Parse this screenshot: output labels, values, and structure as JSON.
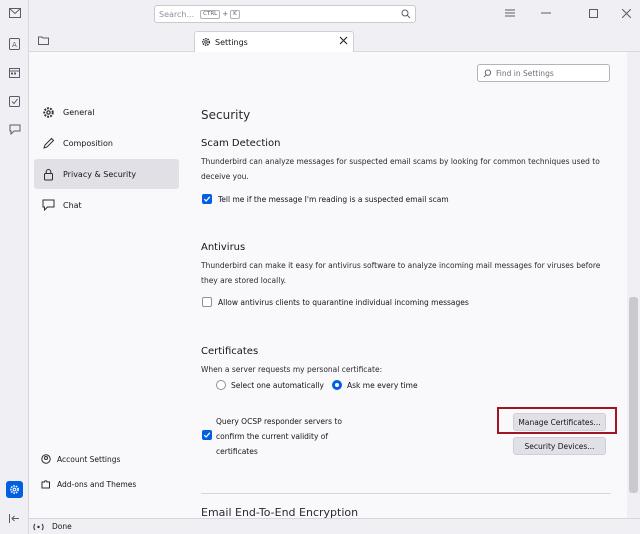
{
  "spaces": {
    "icons": [
      "mail-icon",
      "address-book-icon",
      "calendar-icon",
      "tasks-icon",
      "chat-icon",
      "settings-icon",
      "collapse-icon"
    ],
    "active": "settings-icon"
  },
  "titlebar": {
    "search_placeholder": "Search...",
    "shortcut_key1": "CTRL",
    "shortcut_plus": "+",
    "shortcut_key2": "K"
  },
  "tab": {
    "label": "Settings"
  },
  "sidebar": {
    "items": [
      {
        "label": "General",
        "icon": "gear-icon"
      },
      {
        "label": "Composition",
        "icon": "pencil-icon"
      },
      {
        "label": "Privacy & Security",
        "icon": "lock-icon",
        "selected": true
      },
      {
        "label": "Chat",
        "icon": "chat-icon"
      }
    ],
    "account_settings": "Account Settings",
    "addons": "Add-ons and Themes"
  },
  "find": {
    "placeholder": "Find in Settings"
  },
  "security": {
    "heading": "Security",
    "scam": {
      "title": "Scam Detection",
      "description": "Thunderbird can analyze messages for suspected email scams by looking for common techniques used to deceive you.",
      "checkbox_label": "Tell me if the message I'm reading is a suspected email scam",
      "checked": true
    },
    "antivirus": {
      "title": "Antivirus",
      "description": "Thunderbird can make it easy for antivirus software to analyze incoming mail messages for viruses before they are stored locally.",
      "checkbox_label": "Allow antivirus clients to quarantine individual incoming messages",
      "checked": false
    },
    "certificates": {
      "title": "Certificates",
      "request_label": "When a server requests my personal certificate:",
      "option_auto": "Select one automatically",
      "option_ask": "Ask me every time",
      "selected_option": "Ask me every time",
      "ocsp_line1": "Query OCSP responder servers to",
      "ocsp_line2": "confirm the current validity of",
      "ocsp_line3": "certificates",
      "ocsp_checked": true,
      "manage_button": "Manage Certificates...",
      "devices_button": "Security Devices..."
    }
  },
  "e2e": {
    "heading": "Email End-To-End Encryption"
  },
  "status": {
    "text": "Done"
  },
  "colors": {
    "accent": "#0060df",
    "highlight": "#a01525"
  }
}
